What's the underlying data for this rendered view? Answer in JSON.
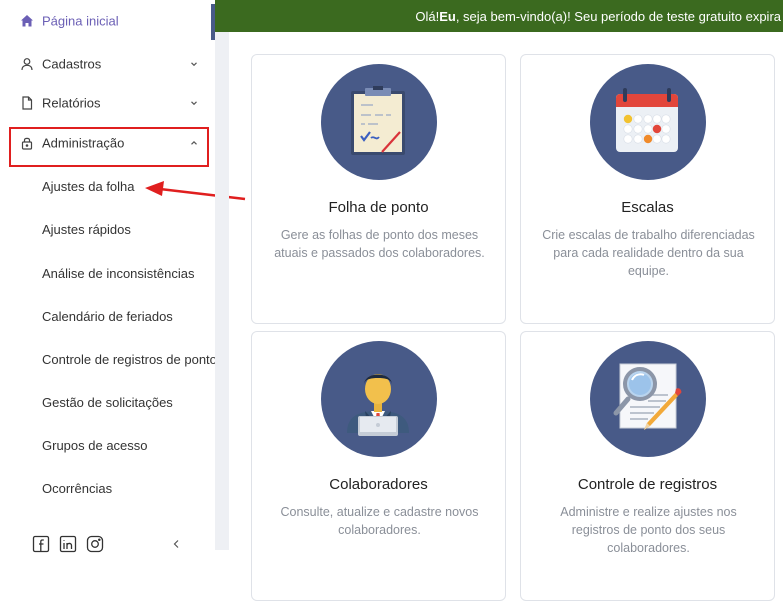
{
  "sidebar": {
    "home": {
      "label": "Página inicial",
      "icon": "home-icon"
    },
    "cadastros": {
      "label": "Cadastros",
      "icon": "user-icon"
    },
    "relatorios": {
      "label": "Relatórios",
      "icon": "file-icon"
    },
    "administracao": {
      "label": "Administração",
      "icon": "lock-icon"
    },
    "submenu": [
      "Ajustes da folha",
      "Ajustes rápidos",
      "Análise de inconsistências",
      "Calendário de feriados",
      "Controle de registros de ponto",
      "Gestão de solicitações",
      "Grupos de acesso",
      "Ocorrências"
    ],
    "footer_icons": [
      "facebook-icon",
      "linkedin-icon",
      "instagram-icon",
      "collapse-icon"
    ]
  },
  "banner": {
    "prefix": "Olá! ",
    "user": "Eu",
    "suffix": ", seja bem-vindo(a)! Seu período de teste gratuito expira"
  },
  "cards": [
    {
      "title": "Folha de ponto",
      "desc": "Gere as folhas de ponto dos meses atuais e passados dos colaboradores.",
      "icon": "timesheet-icon"
    },
    {
      "title": "Escalas",
      "desc": "Crie escalas de trabalho diferenciadas para cada realidade dentro da sua equipe.",
      "icon": "calendar-icon"
    },
    {
      "title": "Colaboradores",
      "desc": "Consulte, atualize e cadastre novos colaboradores.",
      "icon": "employee-icon"
    },
    {
      "title": "Controle de registros",
      "desc": "Administre e realize ajustes nos registros de ponto dos seus colaboradores.",
      "icon": "magnifier-document-icon"
    }
  ],
  "colors": {
    "banner": "#3b6a1f",
    "accent": "#6b5fb5",
    "circle": "#485a88",
    "highlight": "#e01f1f"
  }
}
